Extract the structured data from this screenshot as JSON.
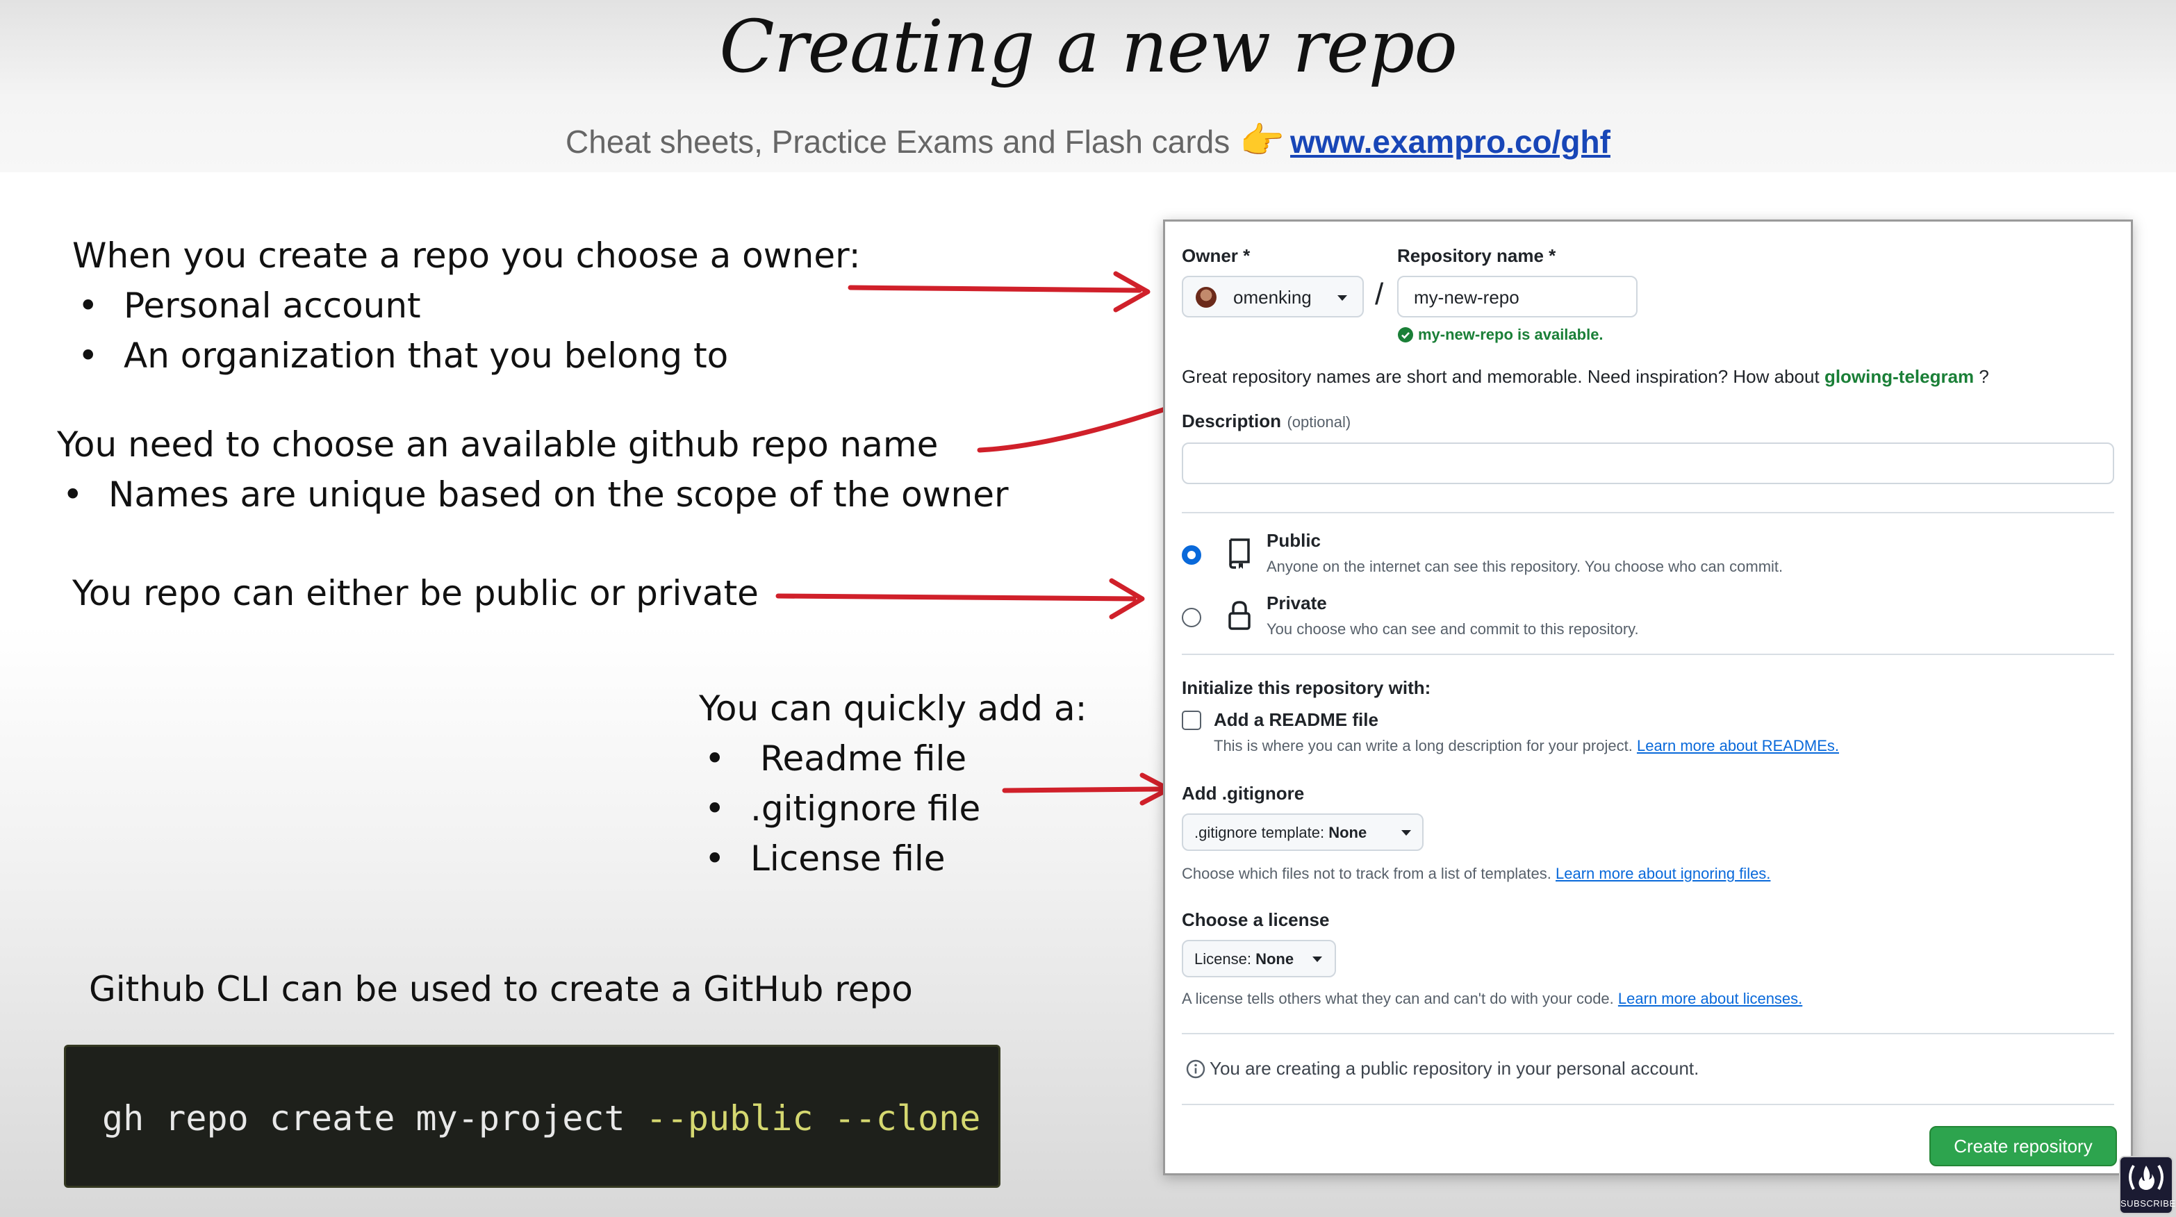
{
  "slide": {
    "title": "Creating a new repo",
    "subtitle_text": "Cheat sheets, Practice Exams and Flash cards",
    "subtitle_emoji": "👉",
    "subtitle_link": "www.exampro.co/ghf"
  },
  "notes": {
    "owner": {
      "heading": "When you create a repo you choose a owner:",
      "items": [
        "Personal account",
        "An organization that you belong to"
      ]
    },
    "name": {
      "heading": "You need to choose an available github repo name",
      "items": [
        "Names are unique based on the scope of the owner"
      ]
    },
    "visibility": {
      "heading": "You repo can either be public or private"
    },
    "quick_add": {
      "heading": "You can quickly add a:",
      "items": [
        "Readme file",
        ".gitignore file",
        "License file"
      ]
    },
    "cli": {
      "heading": "Github CLI can be used to create a GitHub repo"
    }
  },
  "bullet_char": "•",
  "code": {
    "command": "gh repo create my-project ",
    "flags": "--public --clone"
  },
  "form": {
    "owner_label": "Owner *",
    "owner_value": "omenking",
    "slash": "/",
    "repo_label": "Repository name *",
    "repo_value": "my-new-repo",
    "availability": "my-new-repo is available.",
    "inspiration_prefix": "Great repository names are short and memorable. Need inspiration? How about",
    "inspiration_suggestion": "glowing-telegram",
    "inspiration_suffix": "?",
    "description_label": "Description",
    "description_optional": "(optional)",
    "public_label": "Public",
    "public_desc": "Anyone on the internet can see this repository. You choose who can commit.",
    "private_label": "Private",
    "private_desc": "You choose who can see and commit to this repository.",
    "selected_visibility": "Public",
    "init_label": "Initialize this repository with:",
    "readme_label": "Add a README file",
    "readme_checked": false,
    "readme_desc": "This is where you can write a long description for your project.",
    "readme_link": "Learn more about READMEs.",
    "gitignore_label": "Add .gitignore",
    "gitignore_select_prefix": ".gitignore template:",
    "gitignore_select_value": "None",
    "gitignore_desc": "Choose which files not to track from a list of templates.",
    "gitignore_link": "Learn more about ignoring files.",
    "license_label": "Choose a license",
    "license_select_prefix": "License:",
    "license_select_value": "None",
    "license_desc": "A license tells others what they can and can't do with your code.",
    "license_link": "Learn more about licenses.",
    "info_text": "You are creating a public repository in your personal account.",
    "create_button": "Create repository"
  },
  "badge": {
    "label": "SUBSCRIBE"
  },
  "colors": {
    "arrow": "#d0202a",
    "github_green": "#2da44e",
    "link_blue": "#0969da",
    "suggestion_green": "#1a7f37",
    "radio_blue": "#0969da",
    "header_link": "#1846b7"
  },
  "icons": [
    "pointing-hand-emoji",
    "check-circle-icon",
    "repo-icon",
    "lock-icon",
    "info-icon",
    "chevron-down-icon",
    "freecodecamp-logo"
  ]
}
